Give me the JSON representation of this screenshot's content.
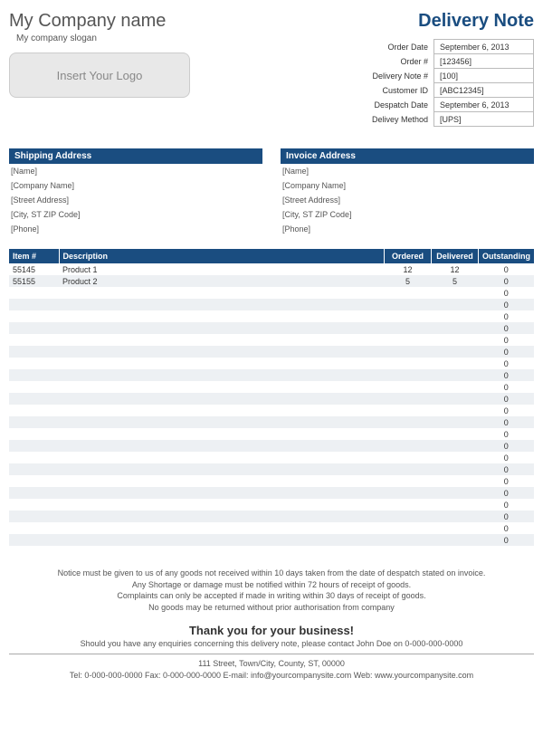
{
  "company": {
    "name": "My Company name",
    "slogan": "My company slogan",
    "logo_placeholder": "Insert Your Logo"
  },
  "doc_title": "Delivery Note",
  "meta": {
    "order_date_label": "Order Date",
    "order_date": "September 6, 2013",
    "order_num_label": "Order #",
    "order_num": "[123456]",
    "delivery_note_label": "Delivery Note #",
    "delivery_note": "[100]",
    "customer_id_label": "Customer ID",
    "customer_id": "[ABC12345]",
    "despatch_date_label": "Despatch Date",
    "despatch_date": "September 6, 2013",
    "delivery_method_label": "Delivey Method",
    "delivery_method": "[UPS]"
  },
  "shipping": {
    "header": "Shipping Address",
    "lines": [
      "[Name]",
      "[Company Name]",
      "[Street Address]",
      "[City, ST  ZIP Code]",
      "[Phone]"
    ]
  },
  "invoice": {
    "header": "Invoice Address",
    "lines": [
      "[Name]",
      "[Company Name]",
      "[Street Address]",
      "[City, ST  ZIP Code]",
      "[Phone]"
    ]
  },
  "items": {
    "headers": {
      "item": "Item #",
      "desc": "Description",
      "ordered": "Ordered",
      "delivered": "Delivered",
      "outstanding": "Outstanding"
    },
    "rows": [
      {
        "item": "55145",
        "desc": "Product 1",
        "ordered": "12",
        "delivered": "12",
        "outstanding": "0"
      },
      {
        "item": "55155",
        "desc": "Product 2",
        "ordered": "5",
        "delivered": "5",
        "outstanding": "0"
      },
      {
        "item": "",
        "desc": "",
        "ordered": "",
        "delivered": "",
        "outstanding": "0"
      },
      {
        "item": "",
        "desc": "",
        "ordered": "",
        "delivered": "",
        "outstanding": "0"
      },
      {
        "item": "",
        "desc": "",
        "ordered": "",
        "delivered": "",
        "outstanding": "0"
      },
      {
        "item": "",
        "desc": "",
        "ordered": "",
        "delivered": "",
        "outstanding": "0"
      },
      {
        "item": "",
        "desc": "",
        "ordered": "",
        "delivered": "",
        "outstanding": "0"
      },
      {
        "item": "",
        "desc": "",
        "ordered": "",
        "delivered": "",
        "outstanding": "0"
      },
      {
        "item": "",
        "desc": "",
        "ordered": "",
        "delivered": "",
        "outstanding": "0"
      },
      {
        "item": "",
        "desc": "",
        "ordered": "",
        "delivered": "",
        "outstanding": "0"
      },
      {
        "item": "",
        "desc": "",
        "ordered": "",
        "delivered": "",
        "outstanding": "0"
      },
      {
        "item": "",
        "desc": "",
        "ordered": "",
        "delivered": "",
        "outstanding": "0"
      },
      {
        "item": "",
        "desc": "",
        "ordered": "",
        "delivered": "",
        "outstanding": "0"
      },
      {
        "item": "",
        "desc": "",
        "ordered": "",
        "delivered": "",
        "outstanding": "0"
      },
      {
        "item": "",
        "desc": "",
        "ordered": "",
        "delivered": "",
        "outstanding": "0"
      },
      {
        "item": "",
        "desc": "",
        "ordered": "",
        "delivered": "",
        "outstanding": "0"
      },
      {
        "item": "",
        "desc": "",
        "ordered": "",
        "delivered": "",
        "outstanding": "0"
      },
      {
        "item": "",
        "desc": "",
        "ordered": "",
        "delivered": "",
        "outstanding": "0"
      },
      {
        "item": "",
        "desc": "",
        "ordered": "",
        "delivered": "",
        "outstanding": "0"
      },
      {
        "item": "",
        "desc": "",
        "ordered": "",
        "delivered": "",
        "outstanding": "0"
      },
      {
        "item": "",
        "desc": "",
        "ordered": "",
        "delivered": "",
        "outstanding": "0"
      },
      {
        "item": "",
        "desc": "",
        "ordered": "",
        "delivered": "",
        "outstanding": "0"
      },
      {
        "item": "",
        "desc": "",
        "ordered": "",
        "delivered": "",
        "outstanding": "0"
      },
      {
        "item": "",
        "desc": "",
        "ordered": "",
        "delivered": "",
        "outstanding": "0"
      }
    ]
  },
  "notice": {
    "l1": "Notice must be given to us of any goods not received within 10 days taken from the date of despatch stated on invoice.",
    "l2": "Any Shortage or damage must be notified within 72 hours of receipt of goods.",
    "l3": "Complaints can only be accepted if made in writing within 30 days of receipt of goods.",
    "l4": "No goods may be returned without prior authorisation from company"
  },
  "thankyou": "Thank you for your business!",
  "enquiry": "Should you have any enquiries concerning this delivery note, please contact John Doe on 0-000-000-0000",
  "footer": {
    "l1": "111 Street, Town/City, County, ST, 00000",
    "l2": "Tel: 0-000-000-0000 Fax: 0-000-000-0000 E-mail: info@yourcompanysite.com Web: www.yourcompanysite.com"
  }
}
